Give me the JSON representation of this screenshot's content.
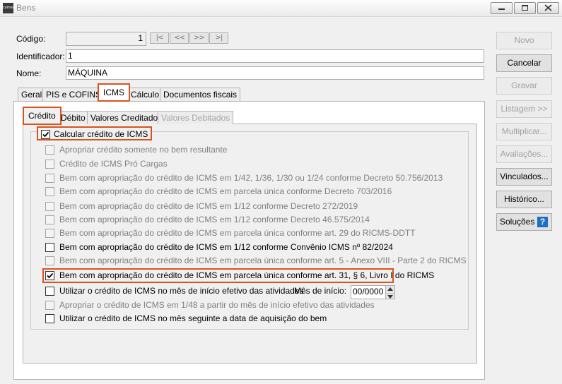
{
  "window": {
    "title": "Bens",
    "app_icon_label": "comenzo"
  },
  "form": {
    "codigo_label": "Código:",
    "codigo_value": "1",
    "identificador_label": "Identificador:",
    "identificador_value": "1",
    "nome_label": "Nome:",
    "nome_value": "MÁQUINA",
    "nav_buttons": [
      "|<",
      "<<",
      ">>",
      ">|"
    ]
  },
  "buttons": {
    "novo": "Novo",
    "cancelar": "Cancelar",
    "gravar": "Gravar",
    "listagem": "Listagem >>",
    "multiplicar": "Multiplicar...",
    "avaliacoes": "Avaliações...",
    "vinculados": "Vinculados...",
    "historico": "Histórico...",
    "solucoes": "Soluções",
    "help": "?"
  },
  "main_tabs": [
    "Geral",
    "PIS e COFINS",
    "ICMS",
    "Cálculo",
    "Documentos fiscais"
  ],
  "sub_tabs": [
    "Crédito",
    "Débito",
    "Valores Creditados",
    "Valores Debitados"
  ],
  "group_title": "Calcular crédito de ICMS",
  "options": [
    "Apropriar crédito somente no bem resultante",
    "Crédito de ICMS Pró Cargas",
    "Bem com apropriação do crédito de ICMS em 1/42, 1/36, 1/30 ou 1/24 conforme Decreto 50.756/2013",
    "Bem com apropriação do crédito de ICMS em parcela única conforme Decreto 703/2016",
    "Bem com apropriação do crédito de ICMS em 1/12 conforme Decreto 272/2019",
    "Bem com apropriação do crédito de ICMS em 1/12 conforme Decreto 46.575/2014",
    "Bem com apropriação do crédito de ICMS em parcela única conforme art. 29 do RICMS-DDTT",
    "Bem com apropriação do crédito de ICMS em 1/12 conforme Convênio ICMS nº 82/2024",
    "Bem com apropriação do crédito de ICMS em parcela única conforme art. 5 - Anexo VIII - Parte 2 do RICMS",
    "Bem com apropriação do crédito de ICMS em parcela única conforme art. 31, § 6, Livro I do RICMS",
    "Utilizar o crédito de ICMS no mês de início efetivo das atividades",
    "Apropriar o crédito de ICMS em 1/48 a partir do mês de início efetivo das atividades",
    "Utilizar o crédito de ICMS no mês seguinte a data de aquisição do bem"
  ],
  "mes_inicio": {
    "label": "Mês de início:",
    "value": "00/0000"
  },
  "colors": {
    "highlight": "#d9531e",
    "help_icon": "#1c6fc4"
  }
}
